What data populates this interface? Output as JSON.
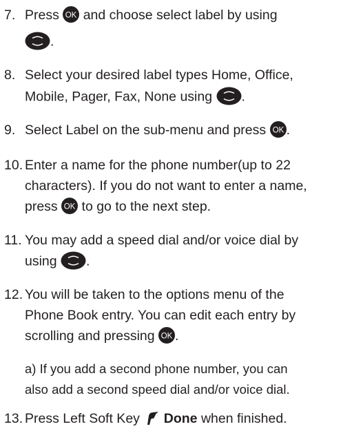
{
  "steps": [
    {
      "num": "7.",
      "l1a": "Press",
      "l1b": "and choose select label by using",
      "l2a": "."
    },
    {
      "num": "8.",
      "l1": "Select your desired label types Home, Office,",
      "l2a": "Mobile, Pager, Fax, None using",
      "l2b": "."
    },
    {
      "num": "9.",
      "l1a": "Select Label on the sub-menu and press",
      "l1b": "."
    },
    {
      "num": "10.",
      "l1": "Enter a name for the phone number(up to 22",
      "l2": "characters). If you do not want to enter a name,",
      "l3a": "press",
      "l3b": "to go to the next step."
    },
    {
      "num": "11.",
      "l1": "You may add a speed dial and/or voice dial by",
      "l2a": "using",
      "l2b": "."
    },
    {
      "num": "12.",
      "l1": "You will be taken to the options menu of the",
      "l2": "Phone Book entry. You can edit each entry by",
      "l3a": "scrolling and pressing",
      "l3b": "."
    },
    {
      "sub1": "a) If you add a second phone number, you can",
      "sub2": "also add a second speed dial and/or voice dial."
    },
    {
      "num": "13.",
      "l1a": "Press Left Soft Key",
      "l1b": "Done",
      "l1c": "when finished."
    }
  ],
  "icons": {
    "ok_text": "OK",
    "ok_button": "ok-button-icon",
    "navigation_key": "navigation-key-icon",
    "left_soft_key": "left-soft-key-icon"
  },
  "colors": {
    "text": "#231f20",
    "icon": "#231f20",
    "icon_text": "#ffffff"
  }
}
